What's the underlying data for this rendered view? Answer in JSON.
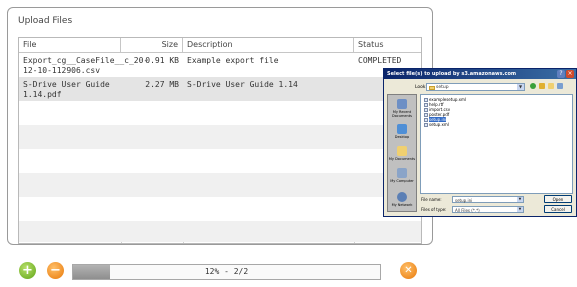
{
  "panel": {
    "title": "Upload Files"
  },
  "table": {
    "headers": {
      "file": "File",
      "size": "Size",
      "description": "Description",
      "status": "Status"
    },
    "rows": [
      {
        "file": "Export_cg__CaseFile__c_20-12-10-112906.csv",
        "size": "0.91 KB",
        "description": "Example export file",
        "status": "COMPLETED"
      },
      {
        "file": "S-Drive User Guide 1.14.pdf",
        "size": "2.27 MB",
        "description": "S-Drive User Guide 1.14",
        "status": ""
      }
    ]
  },
  "controls": {
    "add_glyph": "+",
    "remove_glyph": "−",
    "cancel_glyph": "✕"
  },
  "progress": {
    "percent": 12,
    "label": "12% - 2/2"
  },
  "dialog": {
    "title": "Select file(s) to upload by s3.amazonaws.com",
    "look_in_label": "Look in:",
    "look_in_value": "setup",
    "places": [
      "My Recent Documents",
      "Desktop",
      "My Documents",
      "My Computer",
      "My Network"
    ],
    "files": [
      "examplesetup.xml",
      "help.rtf",
      "import.csv",
      "poster.pdf",
      "setup.ini",
      "setup.xml"
    ],
    "selected_file_index": 4,
    "file_name_label": "File name:",
    "file_name_value": "setup.ini",
    "file_type_label": "Files of type:",
    "file_type_value": "All Files (*.*)",
    "open_label": "Open",
    "cancel_label": "Cancel"
  }
}
